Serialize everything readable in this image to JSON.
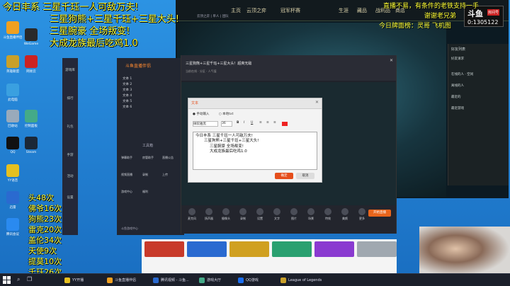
{
  "overlay_left": {
    "lines": [
      "今日丰系 三星千珏一人可敌万夫!",
      "三星狗熊+三星千珏+三星大头!",
      "三星腕豪 全场叛变!",
      "大成龙族最后吃鸡1.0"
    ]
  },
  "counts": {
    "lines": [
      "头48次",
      "佛爷16次",
      "狗熊23次",
      "雷克20次",
      "盖伦34次",
      "天使9次",
      "提莫10次",
      "千珏26次"
    ]
  },
  "overlay_right": {
    "lines": [
      "直播不易，有条件的老铁支持一手",
      "谢谢老兄弟",
      "今日牌面榜：灵哥 飞机图"
    ]
  },
  "logo": {
    "brand": "斗鱼",
    "room_label": "房间号",
    "room_number": "0:1305122"
  },
  "lol_client": {
    "nav": [
      "主页",
      "云顶之弈",
      "冠军杯赛",
      "生涯",
      "藏品",
      "战利品",
      "商店"
    ],
    "status": "云顶之弈 | 单人 | 团队"
  },
  "lol_chat": {
    "header": "好友列表",
    "rows": [
      "好友请求",
      "在线的人 · 空闲",
      "离线的人",
      "最近的",
      "最近游戏"
    ]
  },
  "desktop_icons": [
    {
      "label": "斗鱼直播伴侣",
      "color": "#f0a020"
    },
    {
      "label": "WeGame",
      "color": "#2a2a2a"
    },
    {
      "label": "英雄联盟",
      "color": "#c9a02a"
    },
    {
      "label": "网易云",
      "color": "#c22"
    },
    {
      "label": "此电脑",
      "color": "#3aa0e0"
    },
    {
      "label": "回收站",
      "color": "#9ab"
    },
    {
      "label": "控制面板",
      "color": "#4a8"
    },
    {
      "label": "QQ",
      "color": "#111"
    },
    {
      "label": "Steam",
      "color": "#1b2838"
    },
    {
      "label": "YY语音",
      "color": "#e6c020"
    },
    {
      "label": "迅雷",
      "color": "#2a6ad0"
    },
    {
      "label": "腾讯会议",
      "color": "#2a8af0"
    }
  ],
  "recorder_side": [
    "游戏库",
    "排行",
    "礼包",
    "手游",
    "活动",
    "设置"
  ],
  "recorder": {
    "title": "斗鱼直播伴侣",
    "scenes": [
      "文本 1",
      "文本 2",
      "文本 3",
      "文本 4",
      "文本 5",
      "文本 6"
    ],
    "tools_title": "工具箱",
    "tools": [
      "弹幕助手",
      "房管助手",
      "直播公告",
      "视频直播",
      "录制",
      "上传",
      "游戏中心",
      "福利"
    ],
    "footer": "斗鱼游戏中心"
  },
  "obs": {
    "title": "三星狗熊+三星千珏+三星大头！超爽无敌",
    "subtitle": "当前在线 · 分区 · 人气值",
    "buttons": [
      "麦克风",
      "扬声器",
      "摄像头",
      "录制",
      "设置",
      "文字",
      "图片",
      "场景",
      "特效",
      "美颜",
      "更多"
    ],
    "start_button": "开始直播"
  },
  "dialog": {
    "title": "文本",
    "option_a": "手动输入",
    "option_b": "本地txt",
    "font_label": "微软雅黑",
    "font_size": "36",
    "text_lines": [
      "今日丰系 三星千珏一人可敌万夫!",
      "三星狗熊+三星千珏+三星大头!",
      "三星腕豪 全场叛变!",
      "大成龙族最后吃鸡1.0"
    ],
    "ok": "确定",
    "cancel": "取消"
  },
  "taskbar": {
    "items": [
      {
        "label": "YY开播",
        "color": "#e6c020"
      },
      {
        "label": "斗鱼直播伴侣",
        "color": "#f0a020"
      },
      {
        "label": "腾讯视频 - 斗鱼...",
        "color": "#2a6ad0"
      },
      {
        "label": "游戏大厅",
        "color": "#4a8"
      },
      {
        "label": "QQ游戏",
        "color": "#1b6ef0"
      },
      {
        "label": "League of Legends",
        "color": "#c9a02a"
      }
    ]
  }
}
